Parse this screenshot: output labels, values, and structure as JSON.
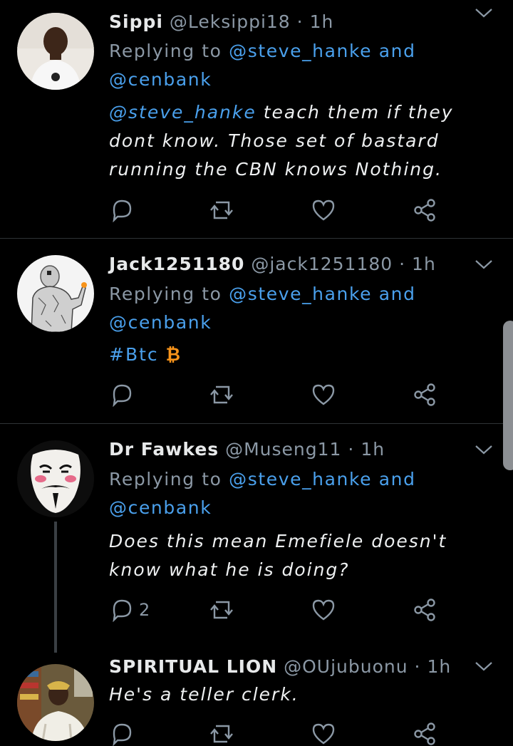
{
  "tweets": [
    {
      "name": "Sippi",
      "handle": "@Leksippi18",
      "time": "1h",
      "replying_prefix": "Replying to",
      "replying_user1": "@steve_hanke",
      "replying_and": "and",
      "replying_user2": "@cenbank",
      "body_mention": "@steve_hanke",
      "body_text": " teach them if they dont know. Those set of bastard running the CBN knows Nothing."
    },
    {
      "name": "Jack1251180",
      "handle": "@jack1251180",
      "time": "1h",
      "replying_prefix": "Replying to",
      "replying_user1": "@steve_hanke",
      "replying_and": "and",
      "replying_user2": "@cenbank",
      "body_hashtag": "#Btc",
      "body_emoji": "₿"
    },
    {
      "name": "Dr Fawkes",
      "handle": "@Museng11",
      "time": "1h",
      "replying_prefix": "Replying to",
      "replying_user1": "@steve_hanke",
      "replying_and": "and",
      "replying_user2": "@cenbank",
      "body_text": "Does this mean Emefiele doesn't know what he is doing?",
      "reply_count": "2"
    },
    {
      "name": "SPIRITUAL LION",
      "handle": "@OUjubuonu",
      "time": "1h",
      "body_text": "He's a teller clerk."
    }
  ],
  "separator": "·",
  "colors": {
    "background": "#000000",
    "link": "#4aa0ec",
    "muted": "#8b98a5",
    "divider": "#2f3336",
    "bitcoin": "#f7931a"
  },
  "icons": [
    "reply-icon",
    "retweet-icon",
    "like-icon",
    "share-icon",
    "caret-down-icon"
  ]
}
